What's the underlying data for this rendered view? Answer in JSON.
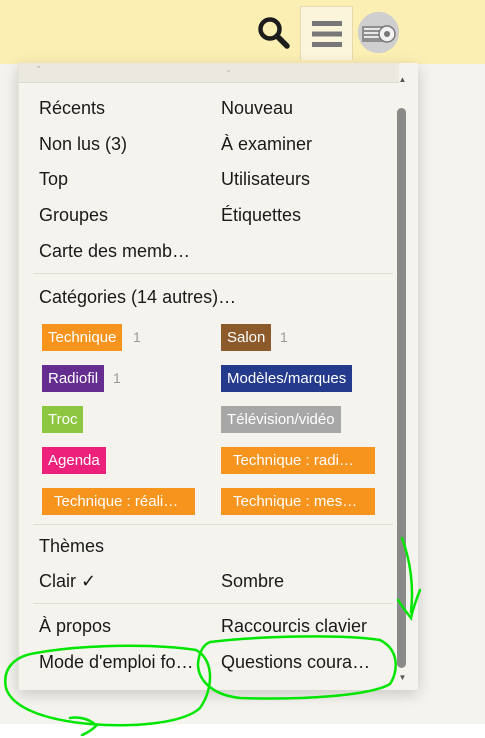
{
  "header": {
    "search_icon": "search-icon",
    "menu_icon": "hamburger-icon",
    "avatar_icon": "user-avatar"
  },
  "panel": {
    "top_left_hint": "ˇ",
    "top_right_hint": "-",
    "nav": [
      {
        "label": "Récents"
      },
      {
        "label": "Nouveau"
      },
      {
        "label": "Non lus (3)"
      },
      {
        "label": "À examiner"
      },
      {
        "label": "Top"
      },
      {
        "label": "Utilisateurs"
      },
      {
        "label": "Groupes"
      },
      {
        "label": "Étiquettes"
      },
      {
        "label": "Carte des memb…"
      }
    ],
    "categories_header": "Catégories (14 autres)…",
    "categories": [
      {
        "label": "Technique",
        "count": "1",
        "color": "#f7941d"
      },
      {
        "label": "Salon",
        "count": "1",
        "color": "#8c5a2b"
      },
      {
        "label": "Radiofil",
        "count": "1",
        "color": "#652d90"
      },
      {
        "label": "Modèles/marques",
        "count": "",
        "color": "#243a8c"
      },
      {
        "label": "Troc",
        "count": "",
        "color": "#8dc63f"
      },
      {
        "label": "Télévision/vidéo",
        "count": "",
        "color": "#a7a7a7"
      },
      {
        "label": "Agenda",
        "count": "",
        "color": "#ed207b"
      },
      {
        "label": "Technique : radi…",
        "count": "",
        "color": "#f7941d"
      },
      {
        "label": "Technique : réali…",
        "count": "",
        "color": "#f7941d"
      },
      {
        "label": "Technique : mes…",
        "count": "",
        "color": "#f7941d"
      }
    ],
    "themes_header": "Thèmes",
    "theme_clair": "Clair ✓",
    "theme_sombre": "Sombre",
    "footer": [
      {
        "label": "À propos"
      },
      {
        "label": "Raccourcis clavier"
      },
      {
        "label": "Mode d'emploi fo…"
      },
      {
        "label": "Questions coura…"
      }
    ]
  },
  "annotation_color": "#00e600"
}
